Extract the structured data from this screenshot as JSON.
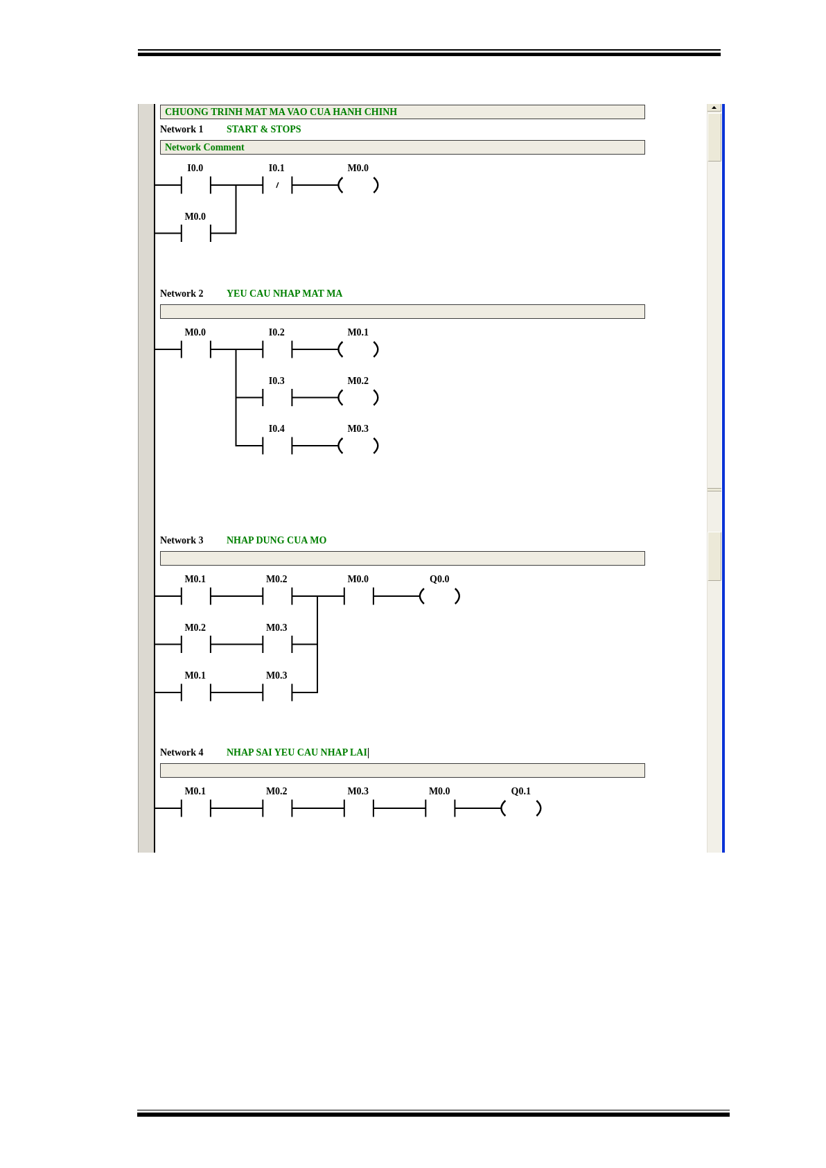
{
  "panels": [
    {
      "program_comment": "CHUONG TRINH MAT MA VAO CUA HANH CHINH",
      "networks": [
        {
          "label": "Network 1",
          "title": "START & STOPS",
          "title_caret": false,
          "comment": "Network Comment",
          "ladder": [
            {
              "kind": "parallel",
              "branches": [
                [
                  {
                    "kind": "contact_no",
                    "operand": "I0.0"
                  }
                ],
                [
                  {
                    "kind": "contact_no",
                    "operand": "M0.0"
                  }
                ]
              ]
            },
            {
              "kind": "contact_nc",
              "operand": "I0.1"
            },
            {
              "kind": "coil",
              "operand": "M0.0"
            }
          ]
        },
        {
          "label": "Network 2",
          "title": "YEU CAU NHAP MAT MA",
          "title_caret": false,
          "ladder": [
            {
              "kind": "contact_no",
              "operand": "M0.0"
            },
            {
              "kind": "parallel",
              "branches": [
                [
                  {
                    "kind": "contact_no",
                    "operand": "I0.2"
                  },
                  {
                    "kind": "coil",
                    "operand": "M0.1"
                  }
                ],
                [
                  {
                    "kind": "contact_no",
                    "operand": "I0.3"
                  },
                  {
                    "kind": "coil",
                    "operand": "M0.2"
                  }
                ],
                [
                  {
                    "kind": "contact_no",
                    "operand": "I0.4"
                  },
                  {
                    "kind": "coil",
                    "operand": "M0.3"
                  }
                ]
              ]
            }
          ]
        }
      ]
    },
    {
      "networks": [
        {
          "label": "Network 3",
          "title": "NHAP DUNG CUA MO",
          "title_caret": false,
          "ladder": [
            {
              "kind": "parallel",
              "branches": [
                [
                  {
                    "kind": "contact_no",
                    "operand": "M0.1"
                  },
                  {
                    "kind": "contact_no",
                    "operand": "M0.2"
                  }
                ],
                [
                  {
                    "kind": "contact_no",
                    "operand": "M0.2"
                  },
                  {
                    "kind": "contact_no",
                    "operand": "M0.3"
                  }
                ],
                [
                  {
                    "kind": "contact_no",
                    "operand": "M0.1"
                  },
                  {
                    "kind": "contact_no",
                    "operand": "M0.3"
                  }
                ]
              ]
            },
            {
              "kind": "contact_no",
              "operand": "M0.0"
            },
            {
              "kind": "coil",
              "operand": "Q0.0"
            }
          ]
        },
        {
          "label": "Network 4",
          "title": "NHAP SAI YEU CAU NHAP LAI",
          "title_caret": true,
          "ladder": [
            {
              "kind": "contact_no",
              "operand": "M0.1"
            },
            {
              "kind": "contact_no",
              "operand": "M0.2"
            },
            {
              "kind": "contact_no",
              "operand": "M0.3"
            },
            {
              "kind": "contact_no",
              "operand": "M0.0"
            },
            {
              "kind": "coil",
              "operand": "Q0.1"
            }
          ]
        }
      ]
    }
  ]
}
